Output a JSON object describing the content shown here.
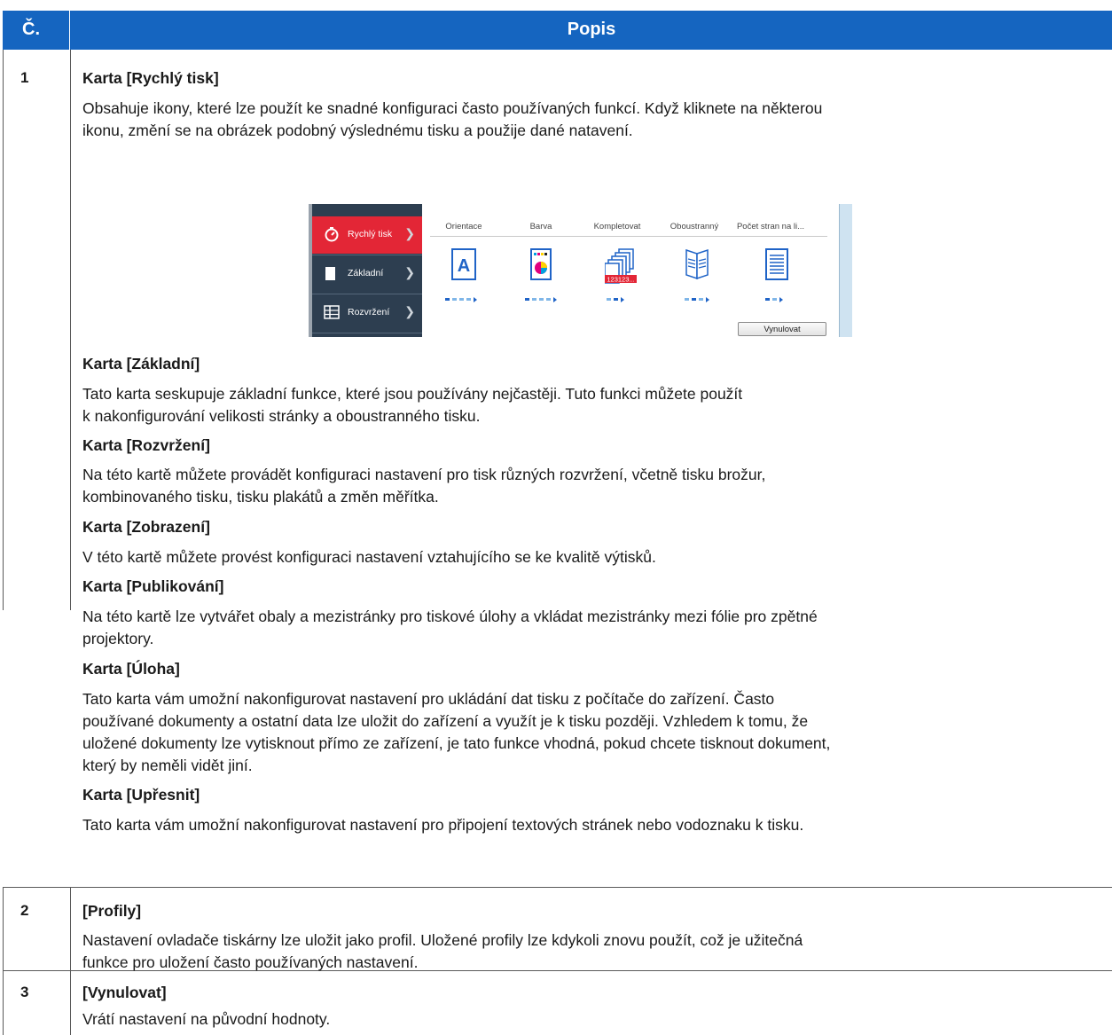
{
  "table": {
    "header": {
      "col1": "Č.",
      "col2": "Popis"
    },
    "rows": [
      {
        "number": "1",
        "sections": [
          {
            "title": "Karta [Rychlý tisk]",
            "lines": [
              "Obsahuje ikony, které lze použít ke snadné konfiguraci často používaných funkcí. Když kliknete na některou",
              "ikonu, změní se na obrázek podobný výslednému tisku a použije dané natavení."
            ]
          },
          {
            "title": "Karta [Základní]",
            "lines": [
              "Tato karta seskupuje základní funkce, které jsou používány nejčastěji. Tuto funkci můžete použít",
              "k nakonfigurování velikosti stránky a oboustranného tisku."
            ]
          },
          {
            "title": "Karta [Rozvržení]",
            "lines": [
              "Na této kartě můžete provádět konfiguraci nastavení pro tisk různých rozvržení, včetně tisku brožur,",
              "kombinovaného tisku, tisku plakátů a změn měřítka."
            ]
          },
          {
            "title": "Karta [Zobrazení]",
            "lines": [
              "V této kartě můžete provést konfiguraci nastavení vztahujícího se ke kvalitě výtisků."
            ]
          },
          {
            "title": "Karta [Publikování]",
            "lines": [
              "Na této kartě lze vytvářet obaly a mezistránky pro tiskové úlohy a vkládat mezistránky mezi fólie pro zpětné",
              "projektory."
            ]
          },
          {
            "title": "Karta [Úloha]",
            "lines": [
              "Tato karta vám umožní nakonfigurovat nastavení pro ukládání dat tisku z počítače do zařízení. Často",
              "používané dokumenty a ostatní data lze uložit do zařízení a využít je k tisku později. Vzhledem k tomu, že",
              "uložené dokumenty lze vytisknout přímo ze zařízení, je tato funkce vhodná, pokud chcete tisknout dokument,",
              "který by neměli vidět jiní."
            ]
          },
          {
            "title": "Karta [Upřesnit]",
            "lines": [
              "Tato karta vám umožní nakonfigurovat nastavení pro připojení textových stránek nebo vodoznaku k tisku."
            ]
          }
        ]
      },
      {
        "number": "2",
        "sections": [
          {
            "title": "[Profily]",
            "lines": [
              "Nastavení ovladače tiskárny lze uložit jako profil. Uložené profily lze kdykoli znovu použít, což je užitečná",
              "funkce pro uložení často používaných nastavení."
            ]
          }
        ]
      },
      {
        "number": "3",
        "sections": [
          {
            "title": "[Vynulovat]",
            "lines": [
              "Vrátí nastavení na původní hodnoty."
            ]
          }
        ]
      }
    ]
  },
  "screenshot": {
    "nav": [
      "Rychlý tisk",
      "Základní",
      "Rozvržení"
    ],
    "columns": [
      "Orientace",
      "Barva",
      "Kompletovat",
      "Oboustranný",
      "Počet stran na li..."
    ],
    "icon_text": {
      "orientation": "A",
      "collate": "123123..."
    },
    "reset_button": "Vynulovat",
    "accent_color": "#e32636",
    "nav_color": "#2d3e50",
    "header_color": "#1565c0"
  }
}
